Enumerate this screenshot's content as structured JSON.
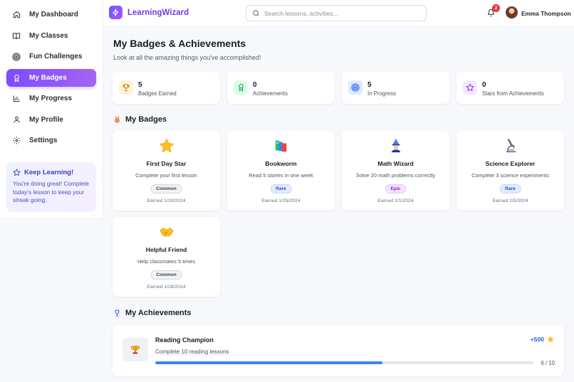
{
  "app": {
    "name": "LearningWizard"
  },
  "sidebar": {
    "items": [
      {
        "label": "My Dashboard",
        "icon": "home-icon"
      },
      {
        "label": "My Classes",
        "icon": "book-icon"
      },
      {
        "label": "Fun Challenges",
        "icon": "target-icon"
      },
      {
        "label": "My Badges",
        "icon": "award-icon",
        "active": true
      },
      {
        "label": "My Progress",
        "icon": "bar-chart-icon"
      },
      {
        "label": "My Profile",
        "icon": "user-icon"
      },
      {
        "label": "Settings",
        "icon": "gear-icon"
      }
    ],
    "promo": {
      "title": "Keep Learning!",
      "text": "You're doing great! Complete today's lesson to keep your streak going."
    }
  },
  "header": {
    "search_placeholder": "Search lessons, activities...",
    "notification_count": "2",
    "user_name": "Emma Thompson"
  },
  "page": {
    "title": "My Badges & Achievements",
    "subtitle": "Look at all the amazing things you've accomplished!"
  },
  "stats": [
    {
      "value": "5",
      "label": "Badges Earned",
      "icon": "trophy-icon",
      "color": "#f59e0b"
    },
    {
      "value": "0",
      "label": "Achievements",
      "icon": "award-icon",
      "color": "#22c55e"
    },
    {
      "value": "5",
      "label": "In Progress",
      "icon": "target-icon",
      "color": "#3b82f6"
    },
    {
      "value": "0",
      "label": "Stars from Achievements",
      "icon": "star-icon",
      "color": "#a855f7"
    }
  ],
  "badges_section": {
    "title": "My Badges"
  },
  "badges": [
    {
      "name": "First Day Star",
      "description": "Complete your first lesson",
      "rarity": "Common",
      "earned": "Earned 1/20/2024",
      "icon": "star-icon"
    },
    {
      "name": "Bookworm",
      "description": "Read 5 stories in one week",
      "rarity": "Rare",
      "earned": "Earned 1/25/2024",
      "icon": "books-icon"
    },
    {
      "name": "Math Wizard",
      "description": "Solve 20 math problems correctly",
      "rarity": "Epic",
      "earned": "Earned 2/1/2024",
      "icon": "wizard-icon"
    },
    {
      "name": "Science Explorer",
      "description": "Complete 3 science experiments",
      "rarity": "Rare",
      "earned": "Earned 2/5/2024",
      "icon": "microscope-icon"
    },
    {
      "name": "Helpful Friend",
      "description": "Help classmates 5 times",
      "rarity": "Common",
      "earned": "Earned 1/28/2024",
      "icon": "handshake-icon"
    }
  ],
  "achievements_section": {
    "title": "My Achievements"
  },
  "achievements": [
    {
      "name": "Reading Champion",
      "description": "Complete 10 reading lessons",
      "points": "+500",
      "progress_text": "6 / 10",
      "progress_fraction": 0.6,
      "icon": "trophy-icon"
    }
  ],
  "colors": {
    "accent": "#7c4dff",
    "brand": "#6d3fe0",
    "progress": "#3b82f6",
    "points": "#2563eb"
  }
}
